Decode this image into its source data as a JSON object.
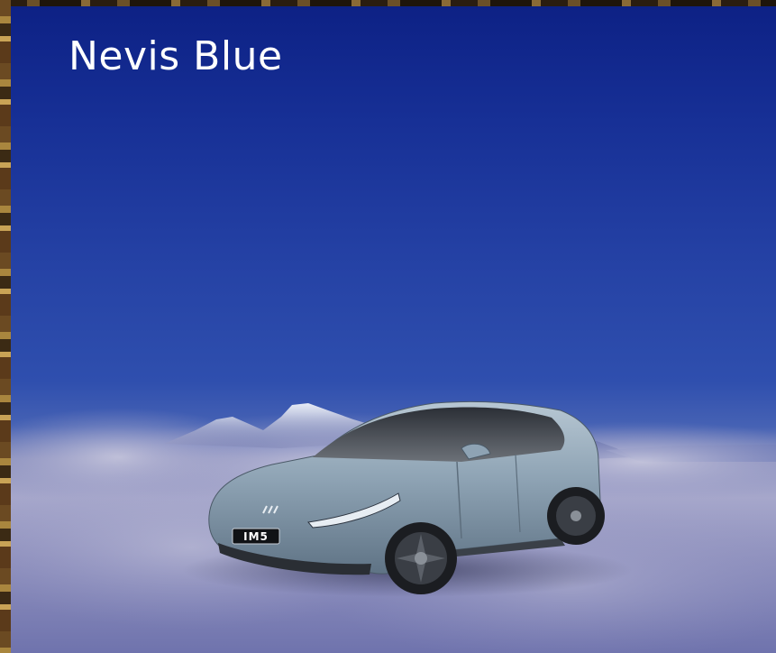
{
  "color_option": {
    "name": "Nevis Blue"
  },
  "car": {
    "badge": "IM5"
  },
  "colors": {
    "sky_top": "#0d2185",
    "sky_mid": "#2f4fae",
    "cloud": "#a6a7cb",
    "body_paint": "#8fa3b4",
    "title_text": "#ffffff"
  }
}
